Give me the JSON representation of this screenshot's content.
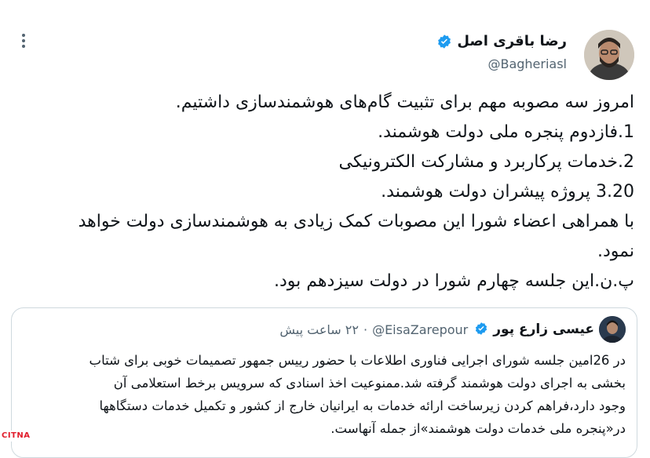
{
  "tweet": {
    "display_name": "رضا باقری اصل",
    "handle": "@Bagheriasl",
    "more_icon": "more-vertical-icon",
    "lines": [
      "امروز سه مصوبه مهم برای تثبیت گام‌های هوشمندسازی داشتیم.",
      "1.فازدوم پنجره ملی دولت هوشمند.",
      "2.خدمات پرکاربرد و مشارکت الکترونیکی",
      "3.20 پروژه پیشران دولت هوشمند.",
      "با همراهی اعضاء شورا این مصوبات کمک زیادی به هوشمندسازی دولت خواهد",
      "نمود.",
      "پ.ن.این جلسه چهارم شورا در دولت سیزدهم  بود."
    ]
  },
  "quoted": {
    "display_name": "عیسی زارع پور",
    "handle": "@EisaZarepour",
    "separator": "·",
    "time": "۲۲ ساعت پیش",
    "lines": [
      "در 26امین جلسه شورای اجرایی فناوری اطلاعات با حضور رییس جمهور تصمیمات خوبی برای شتاب",
      "بخشی به اجرای دولت هوشمند گرفته شد.ممنوعیت اخذ اسنادی که سرویس برخط استعلامی آن",
      "وجود دارد،فراهم کردن زیرساخت ارائه خدمات به ایرانیان خارج از کشور و تکمیل خدمات دستگاهها",
      "در«پنجره ملی خدمات دولت هوشمند»از جمله آنهاست."
    ]
  },
  "watermark": "CITNA",
  "colors": {
    "verified": "#1d9bf0",
    "text": "#0f1419",
    "secondary": "#536471",
    "border": "#cfd9de",
    "watermark": "#e11d2b"
  }
}
